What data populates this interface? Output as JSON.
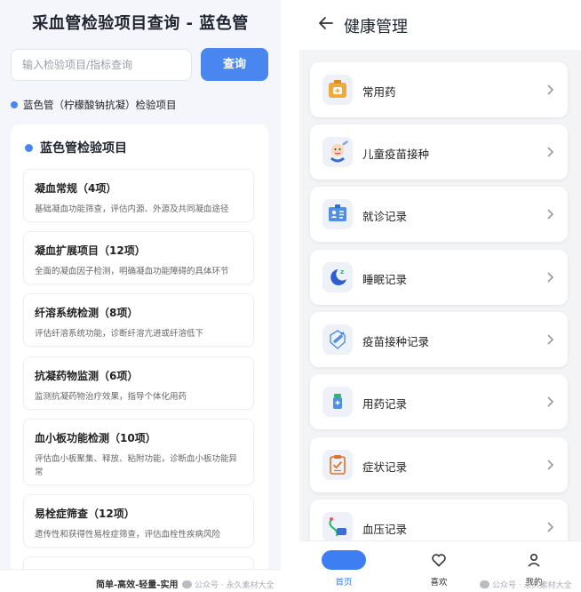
{
  "left": {
    "title": "采血管检验项目查询 - 蓝色管",
    "search": {
      "placeholder": "输入检验项目/指标查询",
      "button": "查询"
    },
    "tube_label": "蓝色管（柠檬酸钠抗凝）检验项目",
    "section_title": "蓝色管检验项目",
    "items": [
      {
        "title": "凝血常规（4项）",
        "desc": "基础凝血功能筛查，评估内源、外源及共同凝血途径"
      },
      {
        "title": "凝血扩展项目（12项）",
        "desc": "全面的凝血因子检测，明确凝血功能障碍的具体环节"
      },
      {
        "title": "纤溶系统检测（8项）",
        "desc": "评估纤溶系统功能，诊断纤溶亢进或纤溶低下"
      },
      {
        "title": "抗凝药物监测（6项）",
        "desc": "监测抗凝药物治疗效果，指导个体化用药"
      },
      {
        "title": "血小板功能检测（10项）",
        "desc": "评估血小板聚集、释放、粘附功能，诊断血小板功能异常"
      },
      {
        "title": "易栓症筛查（12项）",
        "desc": "遗传性和获得性易栓症筛查，评估血栓性疾病风险"
      }
    ],
    "footer_slogan": "简单-高效-轻量-实用",
    "watermark": "公众号 · 永久素材大全"
  },
  "right": {
    "title": "健康管理",
    "rows": [
      {
        "label": "常用药",
        "icon": "medicine-box-icon"
      },
      {
        "label": "儿童疫苗接种",
        "icon": "child-vaccine-icon"
      },
      {
        "label": "就诊记录",
        "icon": "visit-record-icon"
      },
      {
        "label": "睡眠记录",
        "icon": "sleep-moon-icon"
      },
      {
        "label": "疫苗接种记录",
        "icon": "vaccine-syringe-icon"
      },
      {
        "label": "用药记录",
        "icon": "medication-bottle-icon"
      },
      {
        "label": "症状记录",
        "icon": "symptom-clipboard-icon"
      },
      {
        "label": "血压记录",
        "icon": "blood-pressure-icon"
      }
    ],
    "tabs": [
      {
        "label": "首页",
        "icon": "home-icon",
        "active": true
      },
      {
        "label": "喜欢",
        "icon": "heart-icon",
        "active": false
      },
      {
        "label": "我的",
        "icon": "user-icon",
        "active": false
      }
    ],
    "watermark": "公众号 · 永久素材大全"
  },
  "colors": {
    "accent": "#4a86f0",
    "tab_active": "#3d7ef2"
  }
}
